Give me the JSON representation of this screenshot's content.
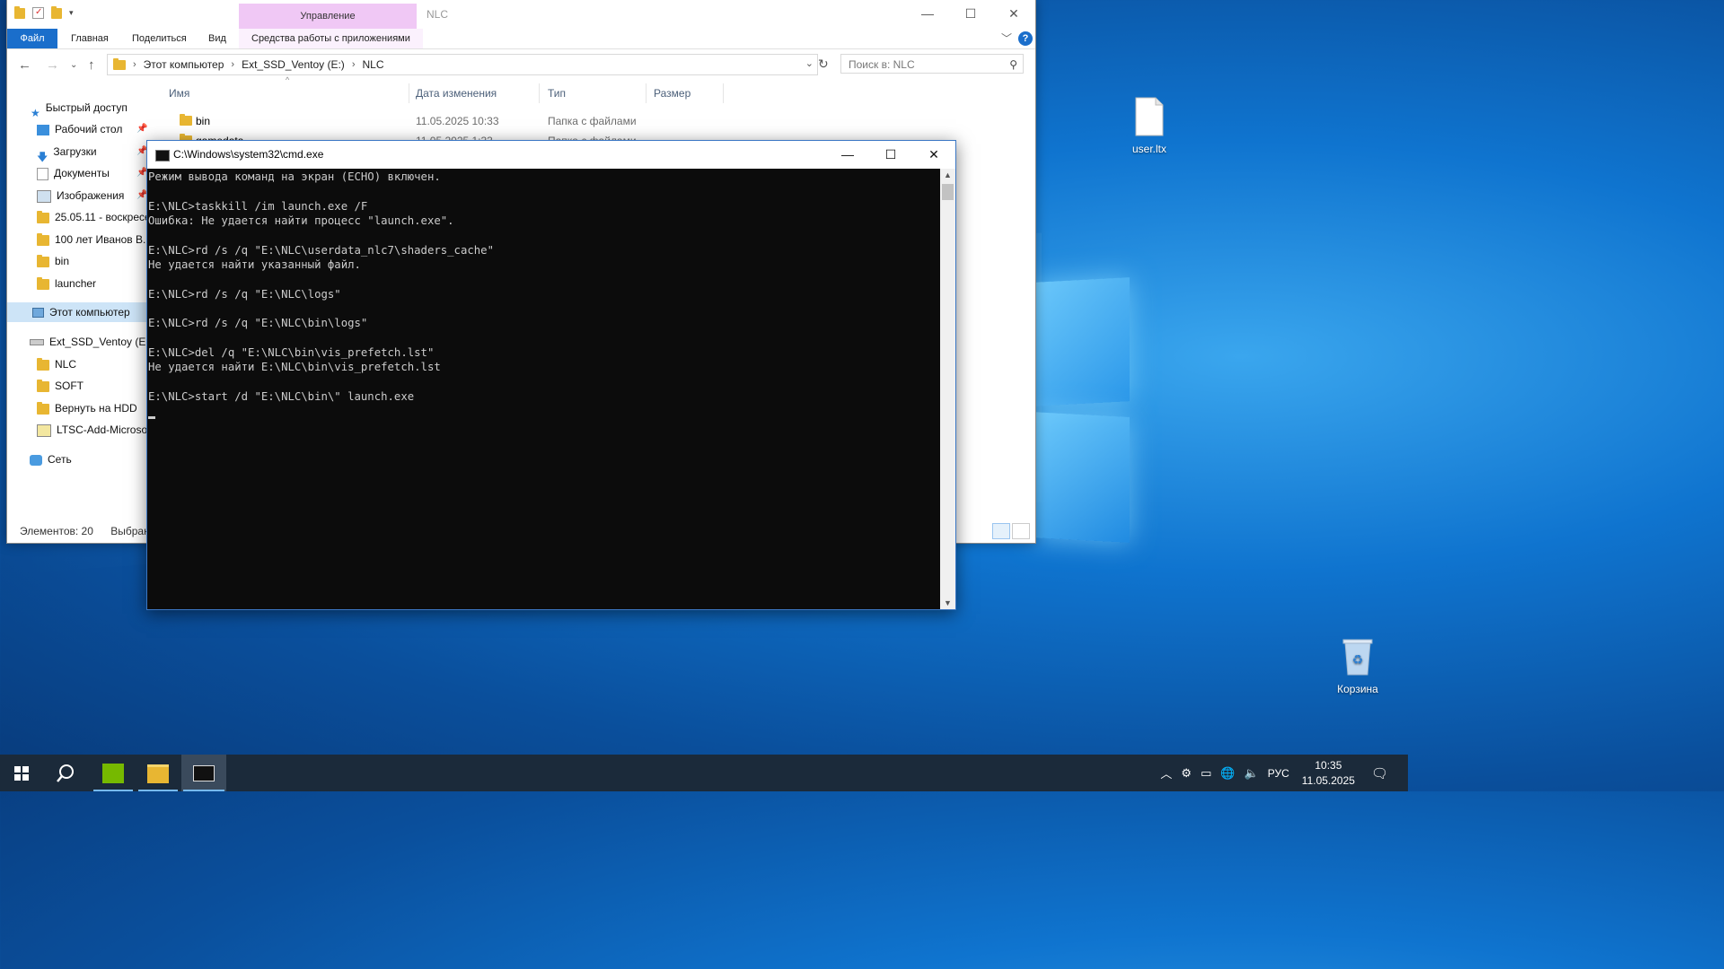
{
  "desktop": {
    "icons": [
      {
        "label": "user.ltx",
        "icon": "document-icon"
      },
      {
        "label": "Корзина",
        "icon": "recycle-bin-icon"
      }
    ]
  },
  "explorer": {
    "folder_name": "NLC",
    "contextual_group": "Управление",
    "ribbon_tabs": [
      "Файл",
      "Главная",
      "Поделиться",
      "Вид",
      "Средства работы с приложениями"
    ],
    "address": [
      "Этот компьютер",
      "Ext_SSD_Ventoy (E:)",
      "NLC"
    ],
    "search_placeholder": "Поиск в: NLC",
    "nav": {
      "quick_access": "Быстрый доступ",
      "quick_items": [
        "Рабочий стол",
        "Загрузки",
        "Документы",
        "Изображения",
        "25.05.11 - воскресенье",
        "100 лет Иванов В.",
        "bin",
        "launcher"
      ],
      "this_pc": "Этот компьютер",
      "drive": "Ext_SSD_Ventoy (E:)",
      "drive_items": [
        "NLC",
        "SOFT",
        "Вернуть на HDD",
        "LTSC-Add-MicrosoftStore"
      ],
      "network": "Сеть"
    },
    "columns": [
      "Имя",
      "Дата изменения",
      "Тип",
      "Размер"
    ],
    "rows": [
      {
        "name": "bin",
        "date": "11.05.2025 10:33",
        "type": "Папка с файлами"
      },
      {
        "name": "gamedata",
        "date": "11.05.2025 1:33",
        "type": "Папка с файлами"
      }
    ],
    "status_count": "Элементов: 20",
    "status_selected": "Выбран"
  },
  "cmd": {
    "title": "C:\\Windows\\system32\\cmd.exe",
    "lines": [
      "Режим вывода команд на экран (ECHO) включен.",
      "",
      "E:\\NLC>taskkill /im launch.exe /F",
      "Ошибка: Не удается найти процесс \"launch.exe\".",
      "",
      "E:\\NLC>rd /s /q \"E:\\NLC\\userdata_nlc7\\shaders_cache\"",
      "Не удается найти указанный файл.",
      "",
      "E:\\NLC>rd /s /q \"E:\\NLC\\logs\"",
      "",
      "E:\\NLC>rd /s /q \"E:\\NLC\\bin\\logs\"",
      "",
      "E:\\NLC>del /q \"E:\\NLC\\bin\\vis_prefetch.lst\"",
      "Не удается найти E:\\NLC\\bin\\vis_prefetch.lst",
      "",
      "E:\\NLC>start /d \"E:\\NLC\\bin\\\" launch.exe"
    ]
  },
  "taskbar": {
    "language": "РУС",
    "time": "10:35",
    "date": "11.05.2025"
  }
}
